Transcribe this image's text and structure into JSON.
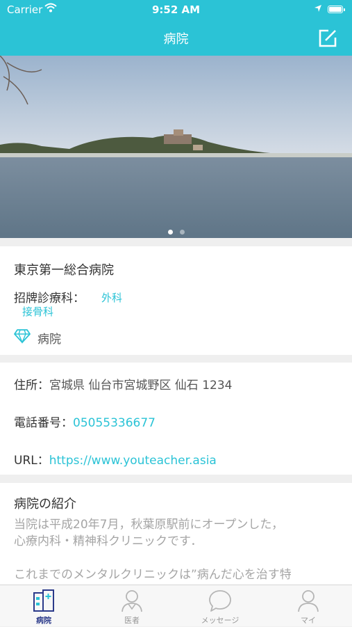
{
  "status_bar": {
    "carrier": "Carrier",
    "time": "9:52 AM"
  },
  "nav": {
    "title": "病院",
    "edit_icon": "edit-icon"
  },
  "banner": {
    "slide_count": 2,
    "active_slide": 1
  },
  "hospital": {
    "name": "東京第一総合病院",
    "departments_label": "招牌診療科：",
    "departments": [
      "外科",
      "接骨科"
    ],
    "type_icon": "diamond-icon",
    "type": "病院"
  },
  "contact": {
    "address_label": "住所：",
    "address": "宮城県 仙台市宮城野区 仙石 1234",
    "phone_label": "電話番号：",
    "phone": "05055336677",
    "url_label": "URL：",
    "url": "https://www.youteacher.asia"
  },
  "intro": {
    "title": "病院の紹介",
    "lines": [
      "当院は平成20年7月，秋葉原駅前にオープンした，",
      "心療内科・精神科クリニックです．",
      "",
      "これまでのメンタルクリニックは”病んだ心を治す特"
    ]
  },
  "tabs": [
    {
      "label": "病院",
      "icon": "hospital-icon",
      "active": true
    },
    {
      "label": "医者",
      "icon": "doctor-icon",
      "active": false
    },
    {
      "label": "メッセージ",
      "icon": "message-icon",
      "active": false
    },
    {
      "label": "マイ",
      "icon": "profile-icon",
      "active": false
    }
  ],
  "colors": {
    "accent": "#2bc3d6",
    "tab_active": "#2b3a8a",
    "tab_inactive": "#999999"
  }
}
